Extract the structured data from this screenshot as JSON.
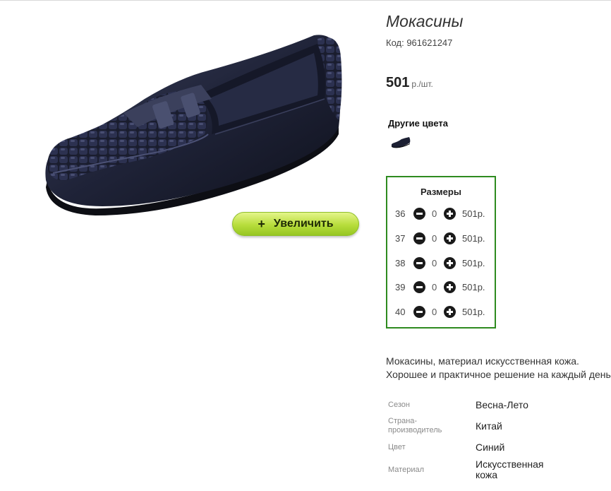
{
  "product": {
    "title": "Мокасины",
    "code": "Код: 961621247",
    "price": "501",
    "price_unit": "р./шт."
  },
  "zoom_button": {
    "icon": "+",
    "label": "Увеличить"
  },
  "other_colors": {
    "heading": "Другие цвета"
  },
  "sizes": {
    "heading": "Размеры",
    "rows": [
      {
        "size": "36",
        "qty": "0",
        "price": "501р."
      },
      {
        "size": "37",
        "qty": "0",
        "price": "501р."
      },
      {
        "size": "38",
        "qty": "0",
        "price": "501р."
      },
      {
        "size": "39",
        "qty": "0",
        "price": "501р."
      },
      {
        "size": "40",
        "qty": "0",
        "price": "501р."
      }
    ]
  },
  "description": "Мокасины, материал искусственная кожа. Хорошее и практичное решение на каждый день.",
  "attributes": [
    {
      "label": "Сезон",
      "value": "Весна-Лето"
    },
    {
      "label": "Страна-производитель",
      "value": "Китай"
    },
    {
      "label": "Цвет",
      "value": "Синий"
    },
    {
      "label": "Материал",
      "value": "Искусственная кожа"
    }
  ],
  "colors": {
    "sizes_border": "#2e8b1f",
    "zoom_button": "#b7dd3b",
    "shoe": "#1c2033"
  }
}
